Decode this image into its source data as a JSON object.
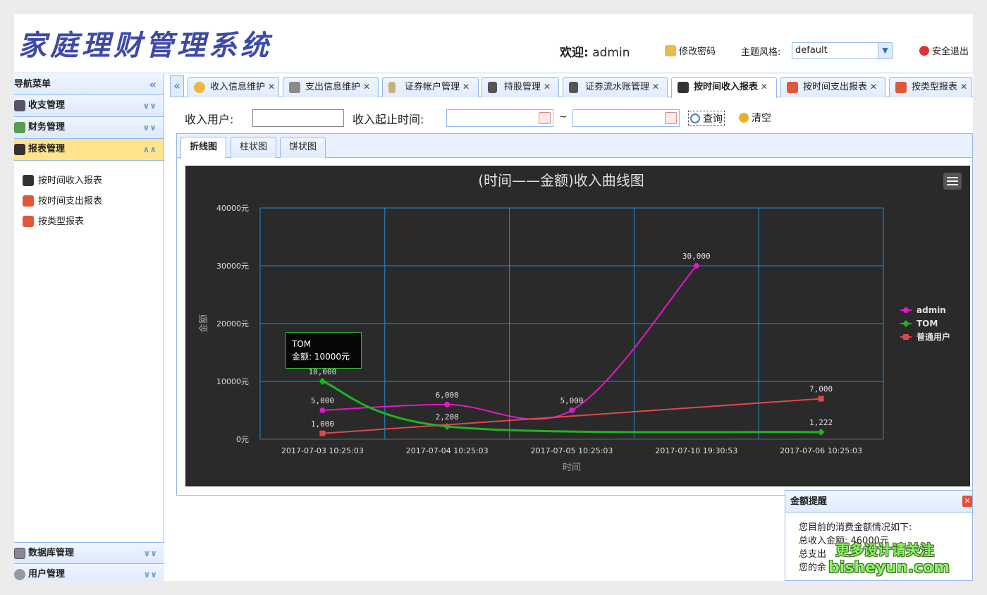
{
  "header": {
    "logo_text": "家庭理财管理系统",
    "welcome_label": "欢迎:",
    "user_name": "admin",
    "change_password": "修改密码",
    "theme_label": "主题风格:",
    "theme_value": "default",
    "logout": "安全退出"
  },
  "sidebar": {
    "title": "导航菜单",
    "sections": [
      {
        "label": "收支管理",
        "icon": "monitor-icon"
      },
      {
        "label": "财务管理",
        "icon": "users-icon"
      },
      {
        "label": "报表管理",
        "icon": "chart-icon"
      }
    ],
    "report_items": [
      {
        "label": "按时间收入报表",
        "icon": "chip-icon"
      },
      {
        "label": "按时间支出报表",
        "icon": "hierarchy-icon"
      },
      {
        "label": "按类型报表",
        "icon": "hierarchy-icon"
      }
    ],
    "bottom_sections": [
      {
        "label": "数据库管理",
        "icon": "database-icon"
      },
      {
        "label": "用户管理",
        "icon": "gear-icon"
      }
    ]
  },
  "tabs": [
    {
      "label": "收入信息维护",
      "icon": "coins-icon"
    },
    {
      "label": "支出信息维护",
      "icon": "wallet-icon"
    },
    {
      "label": "证券帐户管理",
      "icon": "key-icon"
    },
    {
      "label": "持股管理",
      "icon": "doc-icon"
    },
    {
      "label": "证券流水账管理",
      "icon": "doc-icon"
    },
    {
      "label": "按时间收入报表",
      "icon": "chip-icon"
    },
    {
      "label": "按时间支出报表",
      "icon": "hierarchy-icon"
    },
    {
      "label": "按类型报表",
      "icon": "hierarchy-icon"
    }
  ],
  "query": {
    "user_label": "收入用户:",
    "time_label": "收入起止时间:",
    "tilde": "~",
    "search_label": "查询",
    "clear_label": "清空"
  },
  "chart_tabs": [
    "折线图",
    "柱状图",
    "饼状图"
  ],
  "chart_data": {
    "type": "line",
    "title": "(时间——金额)收入曲线图",
    "xlabel": "时间",
    "ylabel": "金额",
    "categories": [
      "2017-07-03 10:25:03",
      "2017-07-04 10:25:03",
      "2017-07-05 10:25:03",
      "2017-07-10 19:30:53",
      "2017-07-06 10:25:03"
    ],
    "y_ticks": [
      "0元",
      "10000元",
      "20000元",
      "30000元",
      "40000元"
    ],
    "ylim": [
      0,
      40000
    ],
    "grid": true,
    "legend_position": "right",
    "series": [
      {
        "name": "admin",
        "color": "#e119c8",
        "marker": "circle",
        "values": [
          5000,
          6000,
          5000,
          30000,
          null
        ],
        "labels": [
          "5,000",
          "6,000",
          "5,000",
          "30,000",
          ""
        ]
      },
      {
        "name": "TOM",
        "color": "#1fb51f",
        "marker": "diamond",
        "values": [
          10000,
          2200,
          null,
          null,
          1222
        ],
        "labels": [
          "10,000",
          "2,200",
          "",
          "",
          "1,222"
        ]
      },
      {
        "name": "普通用户",
        "color": "#e04848",
        "marker": "square",
        "values": [
          1000,
          null,
          null,
          null,
          7000
        ],
        "labels": [
          "1,000",
          "",
          "",
          "",
          "7,000"
        ]
      }
    ],
    "tooltip": {
      "series": "TOM",
      "line": "金额: 10000元"
    }
  },
  "popup": {
    "title": "金额提醒",
    "lines": [
      "您目前的消费金额情况如下:",
      "总收入金额: 46000元",
      "总支出",
      "您的余"
    ]
  },
  "watermark": {
    "line1": "更多设计请关注",
    "line2": "bisheyun.com"
  },
  "colors": {
    "accent": "#95b8e7",
    "active_menu": "#ffe48d",
    "chart_bg": "#2a2a2b"
  }
}
